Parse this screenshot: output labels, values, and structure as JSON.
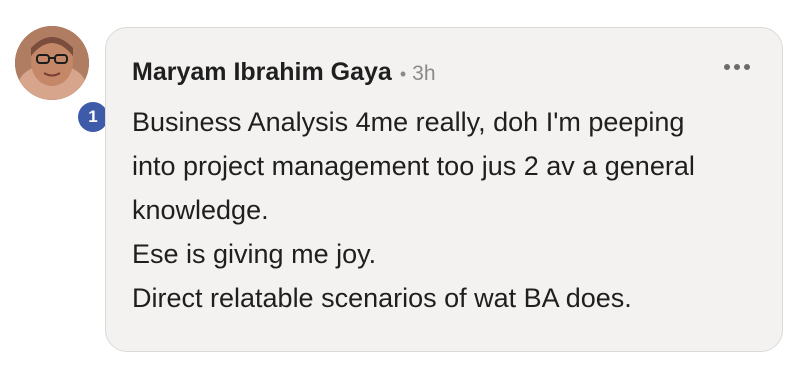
{
  "comment": {
    "author": "Maryam Ibrahim Gaya",
    "separator": "•",
    "timestamp": "3h",
    "notification_count": "1",
    "more_options_icon": "ellipsis-icon",
    "text_lines": [
      "Business Analysis 4me really, doh I'm peeping",
      "into project management too jus 2 av a general",
      "knowledge.",
      "Ese is giving me joy.",
      "Direct relatable scenarios of wat BA does."
    ]
  },
  "colors": {
    "bubble_background": "#f3f2f0",
    "bubble_border": "#dcdad7",
    "badge": "#3d5ba9",
    "text": "#1f1f1f",
    "meta_text": "#8a8a8a"
  }
}
